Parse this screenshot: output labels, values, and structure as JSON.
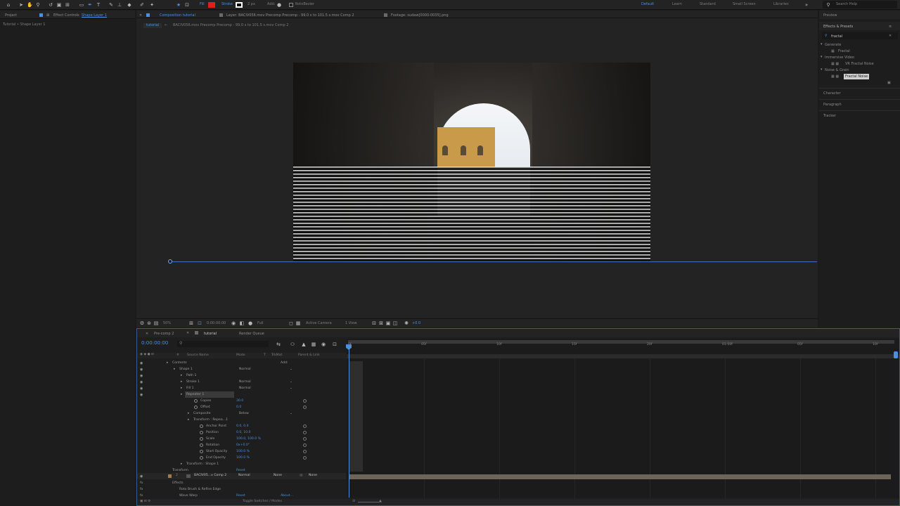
{
  "toolbar": {
    "fill_label": "Fill",
    "stroke_label": "Stroke",
    "stroke_width": "2 px",
    "add_label": "Add:",
    "rotobezier_label": "RotoBezier",
    "workspaces": [
      "Default",
      "Learn",
      "Standard",
      "Small Screen",
      "Libraries"
    ],
    "search_help": "Search Help",
    "fill_color": "#e02020",
    "stroke_color": "#ffffff"
  },
  "left_panel": {
    "tabs": [
      "Project",
      "Effect Controls",
      "Shape Layer 1"
    ],
    "subtitle": "Tutorial • Shape Layer 1"
  },
  "viewer": {
    "tabs": [
      "Composition tutorial",
      "Layer: BACIV056.mov Precomp Precomp - 99.0 s to 101.5 s.mov Comp 2",
      "Footage: sudaw[0000-0035].png"
    ],
    "breadcrumb": [
      "tutorial",
      "BACIV056.mov Precomp Precomp - 99.0 s to 101.5 s.mov Comp 2"
    ],
    "bottom_bar": {
      "zoom": "50%",
      "timecode": "0:00:00:00",
      "resolution": "Full",
      "camera": "Active Camera",
      "views": "1 View",
      "exposure": "+0.0"
    }
  },
  "right_panel": {
    "sections": [
      "Preview",
      "Effects & Presets"
    ],
    "search_value": "fractal",
    "tree": [
      {
        "label": "Generate",
        "level": 0
      },
      {
        "label": "Fractal",
        "level": 1
      },
      {
        "label": "Immersive Video",
        "level": 0
      },
      {
        "label": "VR Fractal Noise",
        "level": 1
      },
      {
        "label": "Noise & Grain",
        "level": 0
      },
      {
        "label": "Fractal Noise",
        "level": 1
      }
    ],
    "other_panels": [
      "Character",
      "Paragraph",
      "Tracker"
    ]
  },
  "timeline": {
    "tabs": [
      "Pre-comp 2",
      "tutorial",
      "Render Queue"
    ],
    "current_time": "0:00:00:00",
    "columns": {
      "source_name": "Source Name",
      "mode": "Mode",
      "t": "T",
      "trkmat": "TrkMat",
      "parent": "Parent & Link"
    },
    "ruler": [
      "0f",
      "05f",
      "10f",
      "15f",
      "20f",
      "01:00f",
      "05f",
      "10f"
    ],
    "rows": [
      {
        "name": "Contents",
        "indent": 50,
        "extra": "Add:"
      },
      {
        "name": "Shape 1",
        "indent": 60,
        "mode": "Normal"
      },
      {
        "name": "Path 1",
        "indent": 70
      },
      {
        "name": "Stroke 1",
        "indent": 70,
        "mode": "Normal"
      },
      {
        "name": "Fill 1",
        "indent": 70,
        "mode": "Normal"
      },
      {
        "name": "Repeater 1",
        "indent": 70
      },
      {
        "name": "Copies",
        "indent": 90,
        "value": "30.0"
      },
      {
        "name": "Offset",
        "indent": 90,
        "value": "0.0"
      },
      {
        "name": "Composite",
        "indent": 80,
        "mode": "Below"
      },
      {
        "name": "Transform : Repea...1",
        "indent": 80
      },
      {
        "name": "Anchor Point",
        "indent": 98,
        "value": "0.0, 0.0"
      },
      {
        "name": "Position",
        "indent": 98,
        "value": "0.0, 10.0"
      },
      {
        "name": "Scale",
        "indent": 98,
        "value": "100.0, 100.0 %"
      },
      {
        "name": "Rotation",
        "indent": 98,
        "value": "0x+0.0°"
      },
      {
        "name": "Start Opacity",
        "indent": 98,
        "value": "100.0 %"
      },
      {
        "name": "End Opacity",
        "indent": 98,
        "value": "100.0 %"
      },
      {
        "name": "Transform : Shape 1",
        "indent": 70
      },
      {
        "name": "Transform",
        "indent": 50,
        "value": "Reset"
      }
    ],
    "layer2": {
      "number": "2",
      "name": "BACIV05...v Comp 2",
      "mode": "Normal",
      "trkmat": "None",
      "parent": "None"
    },
    "effects_rows": [
      {
        "name": "Effects",
        "indent": 50
      },
      {
        "name": "Roto Brush & Refine Edge",
        "indent": 60
      },
      {
        "name": "Wave Warp",
        "indent": 60,
        "value": "Reset",
        "extra": "About..."
      }
    ],
    "footer": "Toggle Switches / Modes"
  }
}
